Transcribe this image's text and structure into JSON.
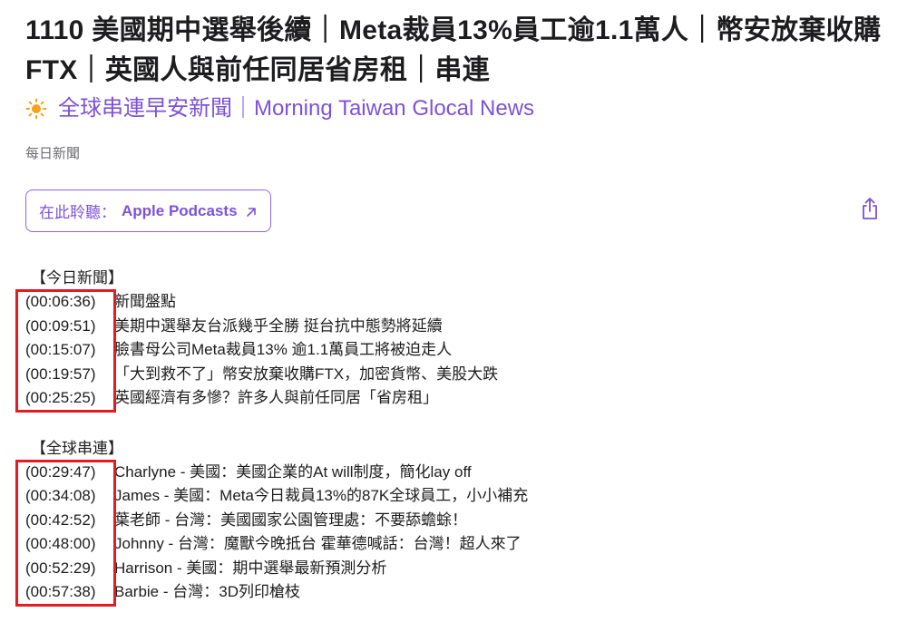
{
  "episode": {
    "title": "1110 美國期中選舉後續｜Meta裁員13%員工逾1.1萬人｜幣安放棄收購FTX｜英國人與前任同居省房租｜串連",
    "show_name": "全球串連早安新聞｜Morning Taiwan Glocal News",
    "category": "每日新聞"
  },
  "listen": {
    "prefix": "在此聆聽：",
    "service": "Apple Podcasts"
  },
  "icons": {
    "show": "sun-icon",
    "external": "arrow-up-right-icon",
    "share": "share-icon"
  },
  "colors": {
    "accent": "#7d52d9",
    "highlight_box": "#e31b23",
    "category_text": "#6e6e73"
  },
  "sections": [
    {
      "heading": "【今日新聞】",
      "items": [
        {
          "time": "(00:06:36)",
          "text": "新聞盤點"
        },
        {
          "time": "(00:09:51)",
          "text": "美期中選舉友台派幾乎全勝 挺台抗中態勢將延續"
        },
        {
          "time": "(00:15:07)",
          "text": "臉書母公司Meta裁員13% 逾1.1萬員工將被迫走人"
        },
        {
          "time": "(00:19:57)",
          "text": "「大到救不了」幣安放棄收購FTX，加密貨幣、美股大跌"
        },
        {
          "time": "(00:25:25)",
          "text": "英國經濟有多慘？許多人與前任同居「省房租」"
        }
      ]
    },
    {
      "heading": "【全球串連】",
      "items": [
        {
          "time": "(00:29:47)",
          "text": "Charlyne - 美國：美國企業的At will制度，簡化lay off"
        },
        {
          "time": "(00:34:08)",
          "text": "James - 美國：Meta今日裁員13%的87K全球員工，小小補充"
        },
        {
          "time": "(00:42:52)",
          "text": "葉老師 - 台灣：美國國家公園管理處：不要舔蟾蜍！"
        },
        {
          "time": "(00:48:00)",
          "text": "Johnny - 台灣：魔獸今晚抵台 霍華德喊話：台灣！超人來了"
        },
        {
          "time": "(00:52:29)",
          "text": "Harrison - 美國：期中選舉最新預測分析"
        },
        {
          "time": "(00:57:38)",
          "text": "Barbie - 台灣：3D列印槍枝"
        }
      ]
    }
  ]
}
